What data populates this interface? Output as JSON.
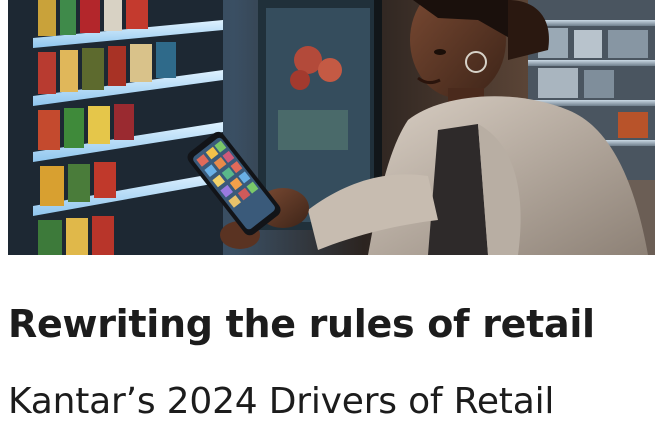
{
  "hero_image": {
    "description_icon": "shopper-using-smartphone-in-store-photo"
  },
  "article": {
    "headline": "Rewriting the rules of retail",
    "subtitle": "Kantar’s 2024 Drivers of Retail"
  },
  "colors": {
    "text": "#1c1c1c",
    "background": "#ffffff",
    "shelf_glow": "#bfe6ff",
    "store_dark": "#1a1e24"
  }
}
